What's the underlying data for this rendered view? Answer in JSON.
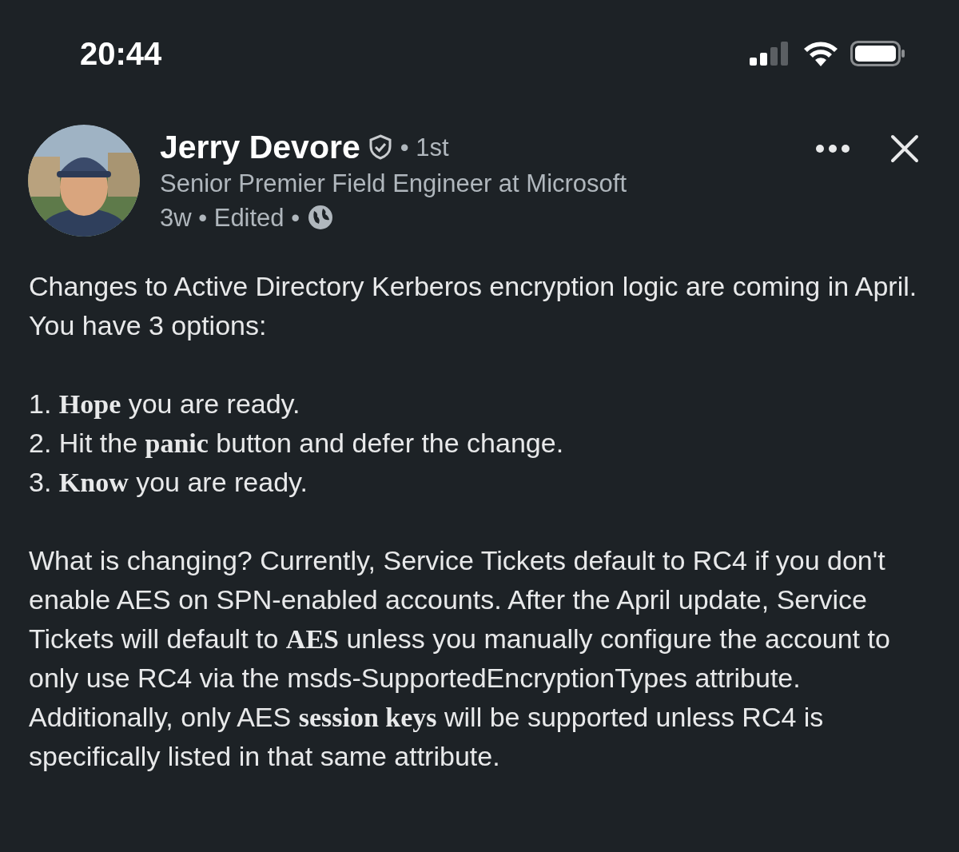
{
  "status_bar": {
    "time": "20:44"
  },
  "post": {
    "author": {
      "name": "Jerry Devore",
      "verified": true,
      "degree": "• 1st",
      "headline": "Senior Premier Field Engineer at Microsoft",
      "meta": "3w • Edited •"
    },
    "body": [
      {
        "kind": "paragraph",
        "text": "Changes to Active Directory Kerberos encryption logic are coming in April. You have 3 options:"
      },
      {
        "kind": "list",
        "items": [
          "1. **Hope** you are ready.",
          "2. Hit the **panic** button and defer the change.",
          "3. **Know** you are ready."
        ]
      },
      {
        "kind": "paragraph",
        "text": "What is changing? Currently, Service Tickets default to RC4 if you don't enable AES on SPN-enabled accounts. After the April update, Service Tickets will default to **AES** unless you manually configure the account to only use RC4 via the msds-SupportedEncryptionTypes attribute. Additionally, only AES **session keys** will be supported unless RC4 is specifically listed in that same attribute."
      }
    ]
  }
}
